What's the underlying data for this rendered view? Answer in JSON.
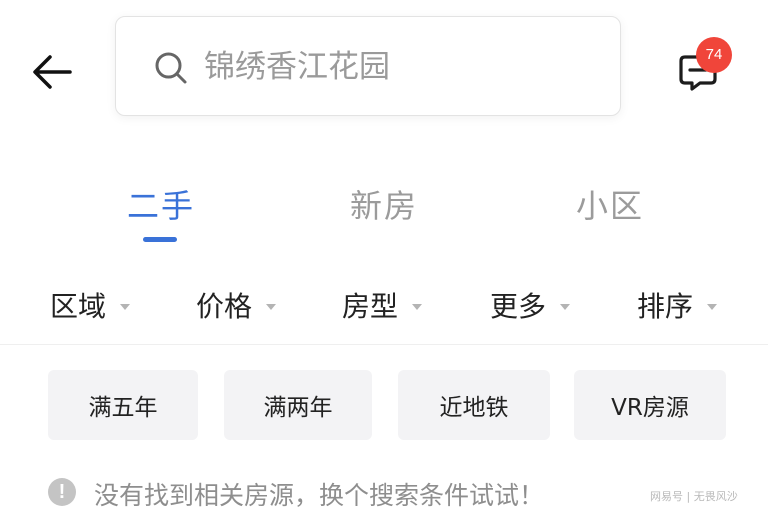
{
  "header": {
    "search": {
      "placeholder": "锦绣香江花园",
      "value": ""
    },
    "messages": {
      "badge_count": "74"
    }
  },
  "tabs": [
    {
      "label": "二手",
      "active": true
    },
    {
      "label": "新房",
      "active": false
    },
    {
      "label": "小区",
      "active": false
    }
  ],
  "filters": [
    {
      "label": "区域"
    },
    {
      "label": "价格"
    },
    {
      "label": "房型"
    },
    {
      "label": "更多"
    },
    {
      "label": "排序"
    }
  ],
  "quick_tags": [
    {
      "label": "满五年"
    },
    {
      "label": "满两年"
    },
    {
      "label": "近地铁"
    },
    {
      "label": "VR房源"
    }
  ],
  "empty_notice": {
    "icon": "exclamation-circle-icon",
    "text": "没有找到相关房源，换个搜索条件试试！"
  },
  "watermark": {
    "text": "网易号 | 无畏风沙"
  },
  "colors": {
    "accent": "#3a72d8",
    "badge": "#f0453a",
    "chip_bg": "#f3f3f5",
    "muted_text": "#9b9b9b"
  }
}
